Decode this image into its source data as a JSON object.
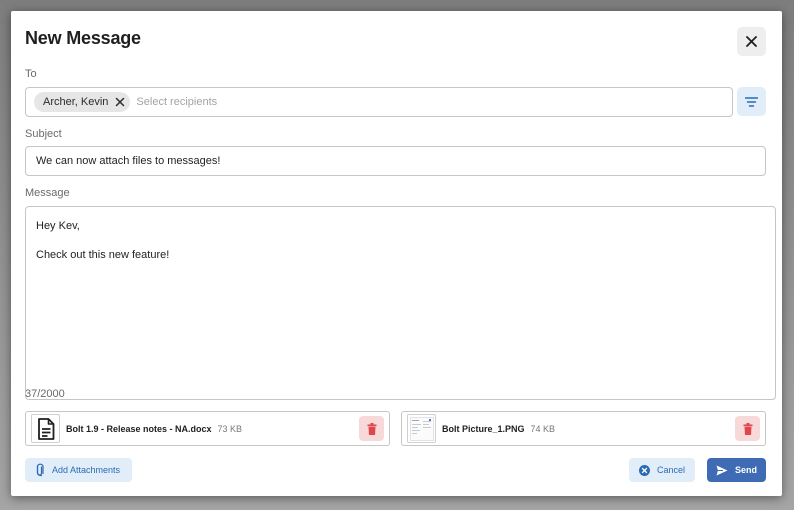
{
  "dialog": {
    "title": "New Message",
    "close_icon": "close-icon"
  },
  "to": {
    "label": "To",
    "chips": [
      {
        "label": "Archer, Kevin"
      }
    ],
    "placeholder": "Select recipients",
    "filter_icon": "filter-icon"
  },
  "subject": {
    "label": "Subject",
    "value": "We can now attach files to messages!"
  },
  "message": {
    "label": "Message",
    "lines": [
      "Hey Kev,",
      "Check out this new feature!"
    ],
    "char_count": "37/2000"
  },
  "attachments": [
    {
      "name": "Bolt 1.9 - Release notes - NA.docx",
      "size": "73 KB",
      "icon": "document-icon"
    },
    {
      "name": "Bolt Picture_1.PNG",
      "size": "74 KB",
      "icon": "image-thumbnail"
    }
  ],
  "actions": {
    "add_attachments": "Add Attachments",
    "cancel": "Cancel",
    "send": "Send"
  },
  "colors": {
    "accent": "#3e6bb4",
    "accent_light": "#e1edf8",
    "danger": "#e0474c",
    "danger_light": "#f7d9d9"
  }
}
